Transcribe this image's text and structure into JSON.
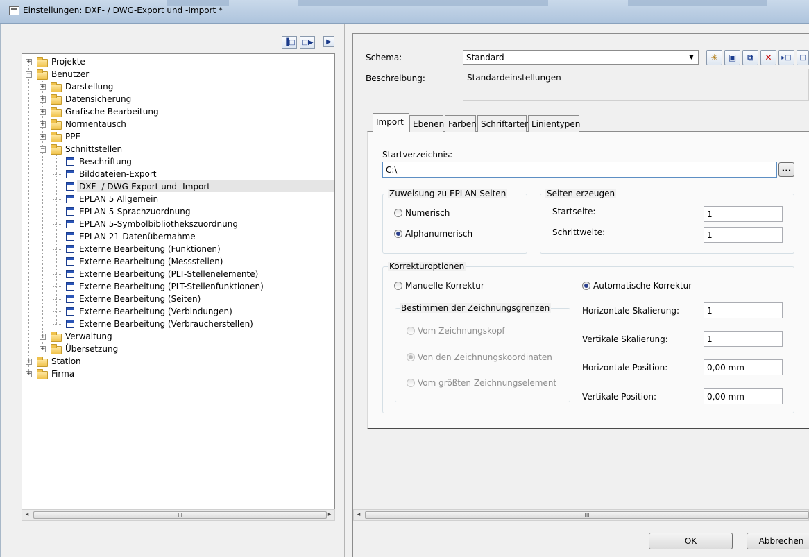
{
  "window": {
    "title": "Einstellungen: DXF- / DWG-Export und -Import *"
  },
  "tree": {
    "nodes": [
      {
        "label": "Projekte"
      },
      {
        "label": "Benutzer"
      },
      {
        "label": "Darstellung"
      },
      {
        "label": "Datensicherung"
      },
      {
        "label": "Grafische Bearbeitung"
      },
      {
        "label": "Normentausch"
      },
      {
        "label": "PPE"
      },
      {
        "label": "Schnittstellen"
      },
      {
        "label": "Beschriftung"
      },
      {
        "label": "Bilddateien-Export"
      },
      {
        "label": "DXF- / DWG-Export und -Import"
      },
      {
        "label": "EPLAN 5 Allgemein"
      },
      {
        "label": "EPLAN 5-Sprachzuordnung"
      },
      {
        "label": "EPLAN 5-Symbolbibliothekszuordnung"
      },
      {
        "label": "EPLAN 21-Datenübernahme"
      },
      {
        "label": "Externe Bearbeitung (Funktionen)"
      },
      {
        "label": "Externe Bearbeitung (Messstellen)"
      },
      {
        "label": "Externe Bearbeitung (PLT-Stellenelemente)"
      },
      {
        "label": "Externe Bearbeitung (PLT-Stellenfunktionen)"
      },
      {
        "label": "Externe Bearbeitung (Seiten)"
      },
      {
        "label": "Externe Bearbeitung (Verbindungen)"
      },
      {
        "label": "Externe Bearbeitung (Verbraucherstellen)"
      },
      {
        "label": "Verwaltung"
      },
      {
        "label": "Übersetzung"
      },
      {
        "label": "Station"
      },
      {
        "label": "Firma"
      }
    ],
    "selected": "DXF- / DWG-Export und -Import"
  },
  "scrollbar": {
    "grip": "III"
  },
  "schema": {
    "label": "Schema:",
    "value": "Standard"
  },
  "description": {
    "label": "Beschreibung:",
    "value": "Standardeinstellungen"
  },
  "tabs": [
    {
      "label": "Import"
    },
    {
      "label": "Ebenen"
    },
    {
      "label": "Farben"
    },
    {
      "label": "Schriftarten"
    },
    {
      "label": "Linientypen"
    }
  ],
  "import": {
    "start_dir_label": "Startverzeichnis:",
    "start_dir_value": "C:\\",
    "browse_label": "...",
    "assignment": {
      "title": "Zuweisung zu EPLAN-Seiten",
      "numeric": "Numerisch",
      "alphanumeric": "Alphanumerisch",
      "selected": "Alphanumerisch"
    },
    "pages": {
      "title": "Seiten erzeugen",
      "start_label": "Startseite:",
      "start_value": "1",
      "step_label": "Schrittweite:",
      "step_value": "1"
    },
    "correction": {
      "title": "Korrekturoptionen",
      "manual": "Manuelle Korrektur",
      "automatic": "Automatische Korrektur",
      "selected": "Automatische Korrektur",
      "bounds_title": "Bestimmen der Zeichnungsgrenzen",
      "bounds_head": "Vom Zeichnungskopf",
      "bounds_coords": "Von den Zeichnungskoordinaten",
      "bounds_largest": "Vom größten Zeichnungselement",
      "bounds_selected": "Von den Zeichnungskoordinaten",
      "h_scale_label": "Horizontale Skalierung:",
      "h_scale_value": "1",
      "v_scale_label": "Vertikale Skalierung:",
      "v_scale_value": "1",
      "h_pos_label": "Horizontale Position:",
      "h_pos_value": "0,00 mm",
      "v_pos_label": "Vertikale Position:",
      "v_pos_value": "0,00 mm"
    }
  },
  "footer": {
    "ok": "OK",
    "cancel": "Abbrechen"
  }
}
